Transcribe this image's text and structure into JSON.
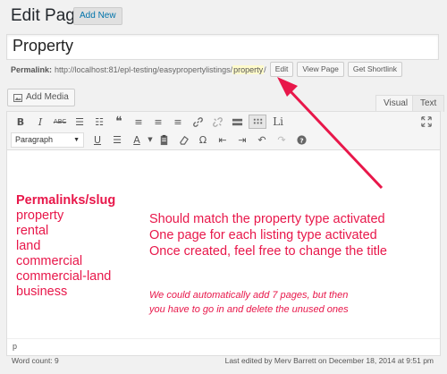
{
  "header": {
    "title": "Edit Page",
    "add_new_label": "Add New"
  },
  "post_title": "Property",
  "permalink": {
    "label": "Permalink:",
    "base": "http://localhost:81/epl-testing/easypropertylistings/",
    "slug": "property",
    "trailing": "/",
    "buttons": [
      "Edit",
      "View Page",
      "Get Shortlink"
    ]
  },
  "media": {
    "add_media_label": "Add Media"
  },
  "tabs": [
    "Visual",
    "Text"
  ],
  "toolbar": {
    "format_value": "Paragraph",
    "row1": [
      {
        "icon": "bold-icon",
        "glyph": "B"
      },
      {
        "icon": "italic-icon",
        "glyph": "I"
      },
      {
        "icon": "strikethrough-icon",
        "glyph": "ABC"
      },
      {
        "icon": "bullet-list-icon",
        "glyph": "☰"
      },
      {
        "icon": "numbered-list-icon",
        "glyph": "☷"
      },
      {
        "icon": "blockquote-icon",
        "glyph": "❝"
      },
      {
        "icon": "align-left-icon",
        "glyph": "≡"
      },
      {
        "icon": "align-center-icon",
        "glyph": "≡"
      },
      {
        "icon": "align-right-icon",
        "glyph": "≡"
      },
      {
        "icon": "link-icon",
        "glyph": "🔗"
      },
      {
        "icon": "unlink-icon",
        "glyph": "⛓"
      },
      {
        "icon": "read-more-icon",
        "glyph": "▬"
      },
      {
        "icon": "toolbar-toggle-icon",
        "glyph": ""
      },
      {
        "icon": "listing-icon",
        "glyph": "Li"
      }
    ],
    "row2": [
      {
        "icon": "underline-icon",
        "glyph": "U"
      },
      {
        "icon": "justify-icon",
        "glyph": "☰"
      },
      {
        "icon": "text-color-icon",
        "glyph": "A"
      },
      {
        "icon": "paste-text-icon",
        "glyph": "📋"
      },
      {
        "icon": "clear-formatting-icon",
        "glyph": "⌫"
      },
      {
        "icon": "special-character-icon",
        "glyph": "Ω"
      },
      {
        "icon": "outdent-icon",
        "glyph": "⇤"
      },
      {
        "icon": "indent-icon",
        "glyph": "⇥"
      },
      {
        "icon": "undo-icon",
        "glyph": "↶"
      },
      {
        "icon": "redo-icon",
        "glyph": "↷"
      },
      {
        "icon": "help-icon",
        "glyph": "?"
      }
    ]
  },
  "content": {
    "slugs_heading": "Permalinks/slug",
    "slugs": [
      "property",
      "rental",
      "land",
      "commercial",
      "commercial-land",
      "business"
    ],
    "notes": [
      "Should match the property type activated",
      "One page for each listing type activated",
      "Once created, feel free to change the title"
    ],
    "italic_note_1": "We could automatically add 7 pages, but then",
    "italic_note_2": "you have to go in and delete the unused ones"
  },
  "pathbar": "p",
  "footer": {
    "word_count": "Word count: 9",
    "last_edited": "Last edited by Merv Barrett on December 18, 2014 at 9:51 pm"
  },
  "colors": {
    "annotation": "#e8174a",
    "link": "#0073aa",
    "slug_highlight": "#fffbcc"
  }
}
